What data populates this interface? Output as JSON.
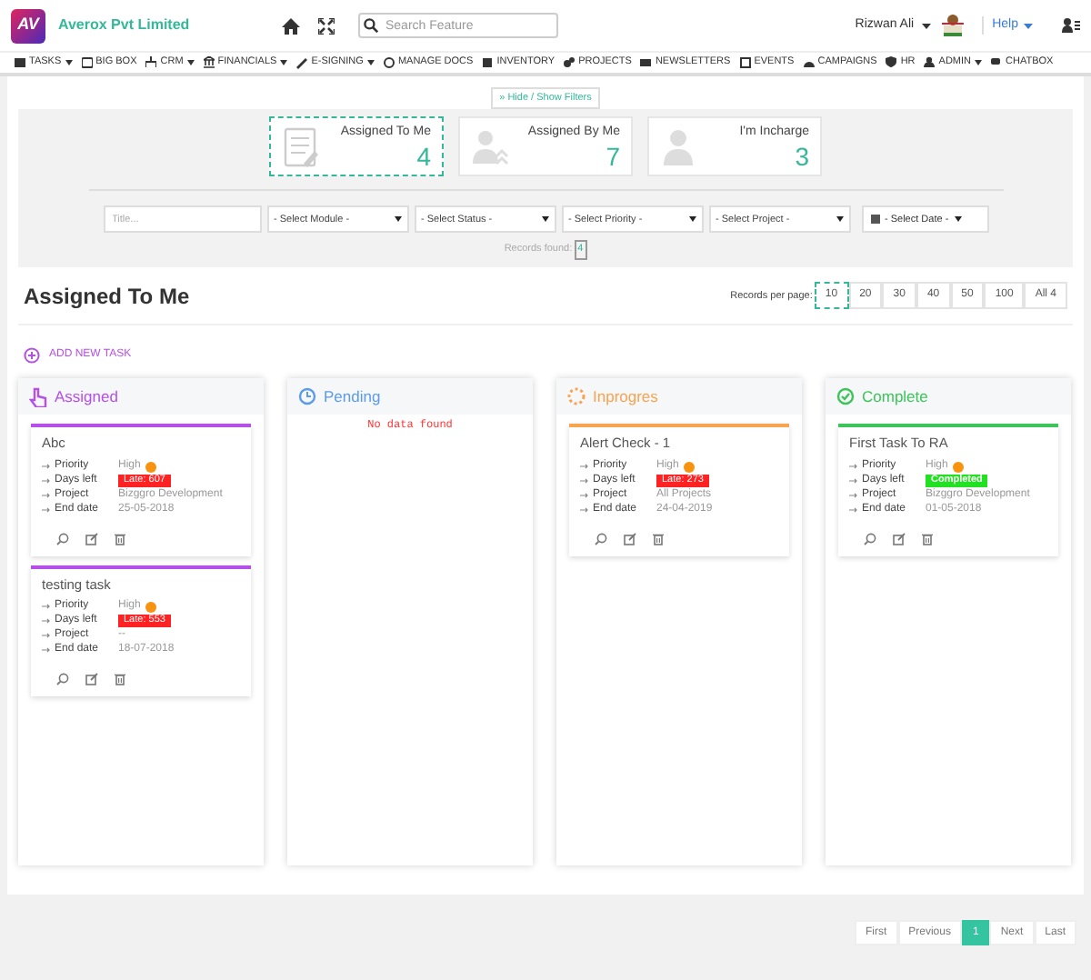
{
  "app": {
    "logo": "AV",
    "company": "Averox Pvt Limited"
  },
  "search": {
    "placeholder": "Search Feature"
  },
  "user": {
    "name": "Rizwan Ali"
  },
  "help": "Help",
  "nav": [
    {
      "label": "TASKS",
      "dropdown": true
    },
    {
      "label": "BIG BOX",
      "dropdown": false
    },
    {
      "label": "CRM",
      "dropdown": true
    },
    {
      "label": "FINANCIALS",
      "dropdown": true
    },
    {
      "label": "E-SIGNING",
      "dropdown": true
    },
    {
      "label": "MANAGE DOCS",
      "dropdown": false
    },
    {
      "label": "INVENTORY",
      "dropdown": false
    },
    {
      "label": "PROJECTS",
      "dropdown": false
    },
    {
      "label": "NEWSLETTERS",
      "dropdown": false
    },
    {
      "label": "EVENTS",
      "dropdown": false
    },
    {
      "label": "CAMPAIGNS",
      "dropdown": false
    },
    {
      "label": "HR",
      "dropdown": false
    },
    {
      "label": "ADMIN",
      "dropdown": true
    },
    {
      "label": "CHATBOX",
      "dropdown": false
    }
  ],
  "filter_toggle": "» Hide / Show Filters",
  "stats": [
    {
      "label": "Assigned To Me",
      "count": "4",
      "selected": true,
      "kind": "notes"
    },
    {
      "label": "Assigned By Me",
      "count": "7",
      "selected": false,
      "kind": "users"
    },
    {
      "label": "I'm Incharge",
      "count": "3",
      "selected": false,
      "kind": "person"
    }
  ],
  "filters": {
    "title_placeholder": "Title...",
    "selects": [
      "- Select Module -",
      "- Select Status -",
      "- Select Priority -",
      "- Select Project -"
    ],
    "date": "- Select Date -"
  },
  "records_found": {
    "label": "Records found:",
    "count": "4"
  },
  "heading": "Assigned To Me",
  "per_page": {
    "label": "Records per page:",
    "options": [
      {
        "label": "10",
        "selected": true
      },
      {
        "label": "20",
        "selected": false
      },
      {
        "label": "30",
        "selected": false
      },
      {
        "label": "40",
        "selected": false
      },
      {
        "label": "50",
        "selected": false
      },
      {
        "label": "100",
        "selected": false
      },
      {
        "label": "All 4",
        "selected": false
      }
    ]
  },
  "add_task": "ADD NEW TASK",
  "columns": [
    {
      "title": "Assigned",
      "kind": "assigned",
      "color": "#b44fe8",
      "tasks": [
        {
          "title": "Abc",
          "fields": [
            {
              "label": "Priority",
              "value": "High",
              "kind": "priority"
            },
            {
              "label": "Days left",
              "value": "Late: 607",
              "kind": "late"
            },
            {
              "label": "Project",
              "value": "Bizggro Development",
              "kind": "text"
            },
            {
              "label": "End date",
              "value": "25-05-2018",
              "kind": "text"
            }
          ]
        },
        {
          "title": "testing task",
          "fields": [
            {
              "label": "Priority",
              "value": "High",
              "kind": "priority"
            },
            {
              "label": "Days left",
              "value": "Late: 553",
              "kind": "late"
            },
            {
              "label": "Project",
              "value": "--",
              "kind": "text"
            },
            {
              "label": "End date",
              "value": "18-07-2018",
              "kind": "text"
            }
          ]
        }
      ]
    },
    {
      "title": "Pending",
      "kind": "pending",
      "color": "#5b9bea",
      "empty": "No data found"
    },
    {
      "title": "Inprogres",
      "kind": "progress",
      "color": "#f7a34f",
      "tasks": [
        {
          "title": "Alert Check - 1",
          "fields": [
            {
              "label": "Priority",
              "value": "High",
              "kind": "priority"
            },
            {
              "label": "Days left",
              "value": "Late: 273",
              "kind": "late"
            },
            {
              "label": "Project",
              "value": "All Projects",
              "kind": "text"
            },
            {
              "label": "End date",
              "value": "24-04-2019",
              "kind": "text"
            }
          ]
        }
      ]
    },
    {
      "title": "Complete",
      "kind": "complete",
      "color": "#3cc45a",
      "tasks": [
        {
          "title": "First Task To RA",
          "fields": [
            {
              "label": "Priority",
              "value": "High",
              "kind": "priority"
            },
            {
              "label": "Days left",
              "value": "Completed",
              "kind": "done"
            },
            {
              "label": "Project",
              "value": "Bizggro Development",
              "kind": "text"
            },
            {
              "label": "End date",
              "value": "01-05-2018",
              "kind": "text"
            }
          ]
        }
      ]
    }
  ],
  "pagination": [
    {
      "label": "First",
      "selected": false
    },
    {
      "label": "Previous",
      "selected": false
    },
    {
      "label": "1",
      "selected": true
    },
    {
      "label": "Next",
      "selected": false
    },
    {
      "label": "Last",
      "selected": false
    }
  ]
}
